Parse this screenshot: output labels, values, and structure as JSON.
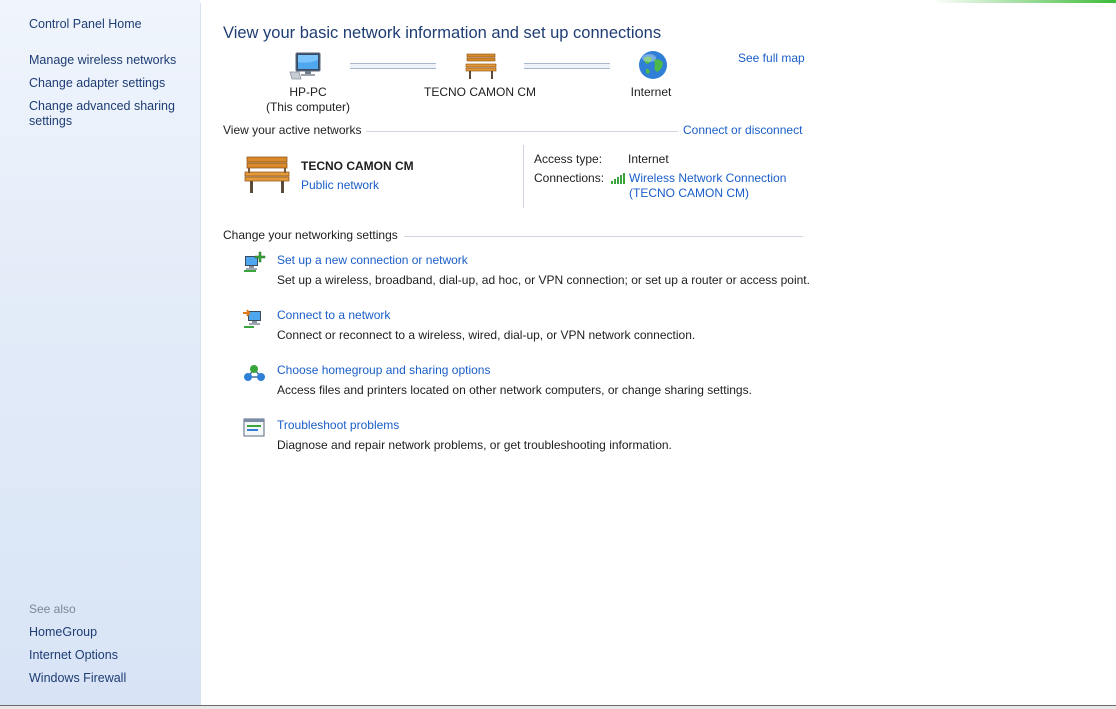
{
  "sidebar": {
    "home": "Control Panel Home",
    "items": [
      {
        "label": "Manage wireless networks"
      },
      {
        "label": "Change adapter settings"
      },
      {
        "label": "Change advanced sharing settings"
      }
    ],
    "see_also_label": "See also",
    "see_also": [
      {
        "label": "HomeGroup"
      },
      {
        "label": "Internet Options"
      },
      {
        "label": "Windows Firewall"
      }
    ]
  },
  "main": {
    "title": "View your basic network information and set up connections",
    "see_full_map": "See full map",
    "map": {
      "computer_name": "HP-PC",
      "computer_sub": "(This computer)",
      "network_name": "TECNO CAMON CM",
      "internet_label": "Internet"
    },
    "active_networks": {
      "heading": "View your active networks",
      "connect_link": "Connect or disconnect",
      "network_name": "TECNO CAMON CM",
      "network_category": "Public network",
      "access_type_label": "Access type:",
      "access_type_value": "Internet",
      "connections_label": "Connections:",
      "connection_value_line1": "Wireless Network Connection",
      "connection_value_line2": "(TECNO CAMON CM)"
    },
    "settings": {
      "heading": "Change your networking settings",
      "tasks": [
        {
          "icon": "new-connection-icon",
          "link": "Set up a new connection or network",
          "desc": "Set up a wireless, broadband, dial-up, ad hoc, or VPN connection; or set up a router or access point."
        },
        {
          "icon": "connect-network-icon",
          "link": "Connect to a network",
          "desc": "Connect or reconnect to a wireless, wired, dial-up, or VPN network connection."
        },
        {
          "icon": "homegroup-icon",
          "link": "Choose homegroup and sharing options",
          "desc": "Access files and printers located on other network computers, or change sharing settings."
        },
        {
          "icon": "troubleshoot-icon",
          "link": "Troubleshoot problems",
          "desc": "Diagnose and repair network problems, or get troubleshooting information."
        }
      ]
    }
  },
  "colors": {
    "link": "#1a5ec8",
    "title": "#1e3d73",
    "sidebar_bg": "#e2ebf8",
    "accent_green": "#3dbb38"
  }
}
